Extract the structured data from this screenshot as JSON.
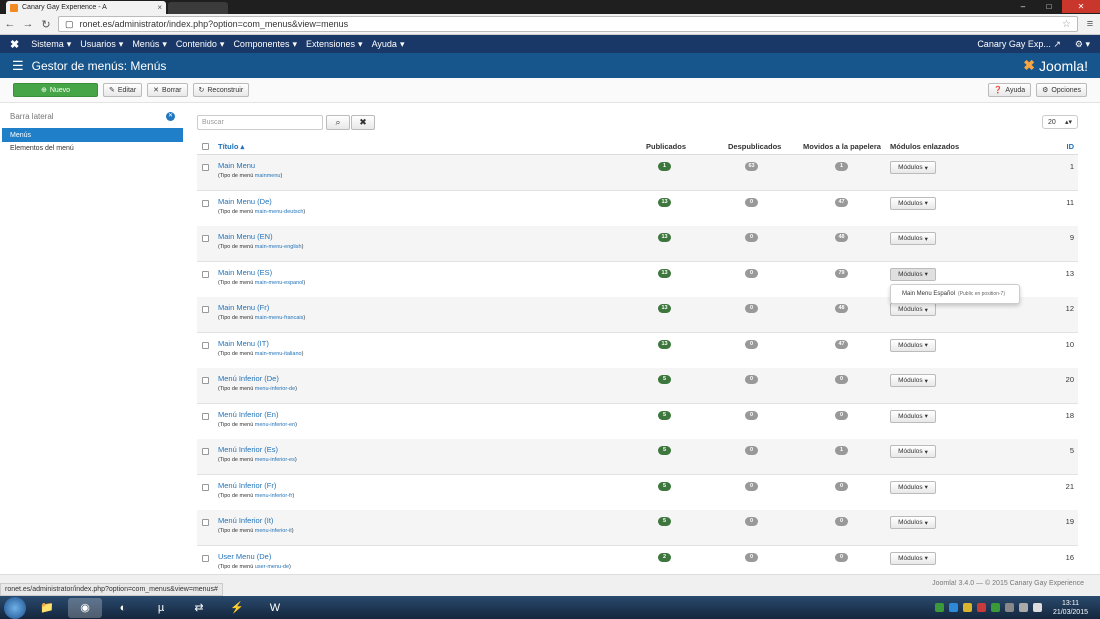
{
  "browser": {
    "tab_title": "Canary Gay Experience - A",
    "url": "ronet.es/administrator/index.php?option=com_menus&view=menus",
    "status_url": "ronet.es/administrator/index.php?option=com_menus&view=menus#"
  },
  "topnav": {
    "items": [
      "Sistema",
      "Usuarios",
      "Menús",
      "Contenido",
      "Componentes",
      "Extensiones",
      "Ayuda"
    ],
    "site_name": "Canary Gay Exp..."
  },
  "header": {
    "title": "Gestor de menús: Menús",
    "brand": "Joomla!"
  },
  "toolbar": {
    "new_label": "Nuevo",
    "edit_label": "Editar",
    "delete_label": "Borrar",
    "rebuild_label": "Reconstruir",
    "help_label": "Ayuda",
    "options_label": "Opciones"
  },
  "sidebar": {
    "heading": "Barra lateral",
    "items": [
      {
        "label": "Menús",
        "active": true
      },
      {
        "label": "Elementos del menú",
        "active": false
      }
    ]
  },
  "filter": {
    "search_placeholder": "Buscar",
    "limit": "20"
  },
  "table": {
    "headers": {
      "title": "Título",
      "published": "Publicados",
      "unpublished": "Despublicados",
      "trashed": "Movidos a la papelera",
      "modules": "Módulos enlazados",
      "id": "ID"
    },
    "type_prefix": "(Tipo de menú",
    "modules_label": "Módulos",
    "rows": [
      {
        "title": "Main Menu",
        "type": "mainmenu",
        "pub": "1",
        "unpub": "63",
        "trash": "1",
        "id": "1"
      },
      {
        "title": "Main Menu (De)",
        "type": "main-menu-deutsch",
        "pub": "13",
        "unpub": "0",
        "trash": "47",
        "id": "11"
      },
      {
        "title": "Main Menu (EN)",
        "type": "main-menu-english",
        "pub": "13",
        "unpub": "0",
        "trash": "48",
        "id": "9"
      },
      {
        "title": "Main Menu (ES)",
        "type": "main-menu-espanol",
        "pub": "13",
        "unpub": "0",
        "trash": "79",
        "id": "13"
      },
      {
        "title": "Main Menu (Fr)",
        "type": "main-menu-francais",
        "pub": "13",
        "unpub": "0",
        "trash": "48",
        "id": "12"
      },
      {
        "title": "Main Menu (IT)",
        "type": "main-menu-italiano",
        "pub": "13",
        "unpub": "0",
        "trash": "47",
        "id": "10"
      },
      {
        "title": "Menú Inferior (De)",
        "type": "menu-inferior-de",
        "pub": "5",
        "unpub": "0",
        "trash": "0",
        "id": "20"
      },
      {
        "title": "Menú Inferior (En)",
        "type": "menu-inferior-en",
        "pub": "5",
        "unpub": "0",
        "trash": "0",
        "id": "18"
      },
      {
        "title": "Menú Inferior (Es)",
        "type": "menu-inferior-es",
        "pub": "5",
        "unpub": "0",
        "trash": "1",
        "id": "5"
      },
      {
        "title": "Menú Inferior (Fr)",
        "type": "menu-inferior-fr",
        "pub": "5",
        "unpub": "0",
        "trash": "0",
        "id": "21"
      },
      {
        "title": "Menú Inferior (It)",
        "type": "menu-inferior-it",
        "pub": "5",
        "unpub": "0",
        "trash": "0",
        "id": "19"
      },
      {
        "title": "User Menu (De)",
        "type": "user-menu-de",
        "pub": "2",
        "unpub": "0",
        "trash": "0",
        "id": "16"
      }
    ]
  },
  "dropdown": {
    "module_name": "Main Menu Español",
    "module_position": "(Public en position-7)"
  },
  "footer": {
    "copyright": "Joomla! 3.4.0 — © 2015 Canary Gay Experience"
  },
  "taskbar": {
    "time": "13:11",
    "date": "21/03/2015"
  },
  "colors": {
    "nav_bg": "#1a3867",
    "header_bg": "#17568c",
    "new_btn": "#46a546",
    "badge_green": "#3d773d",
    "badge_grey": "#999999",
    "link": "#2273b9",
    "sidebar_active": "#1f7fc9"
  }
}
